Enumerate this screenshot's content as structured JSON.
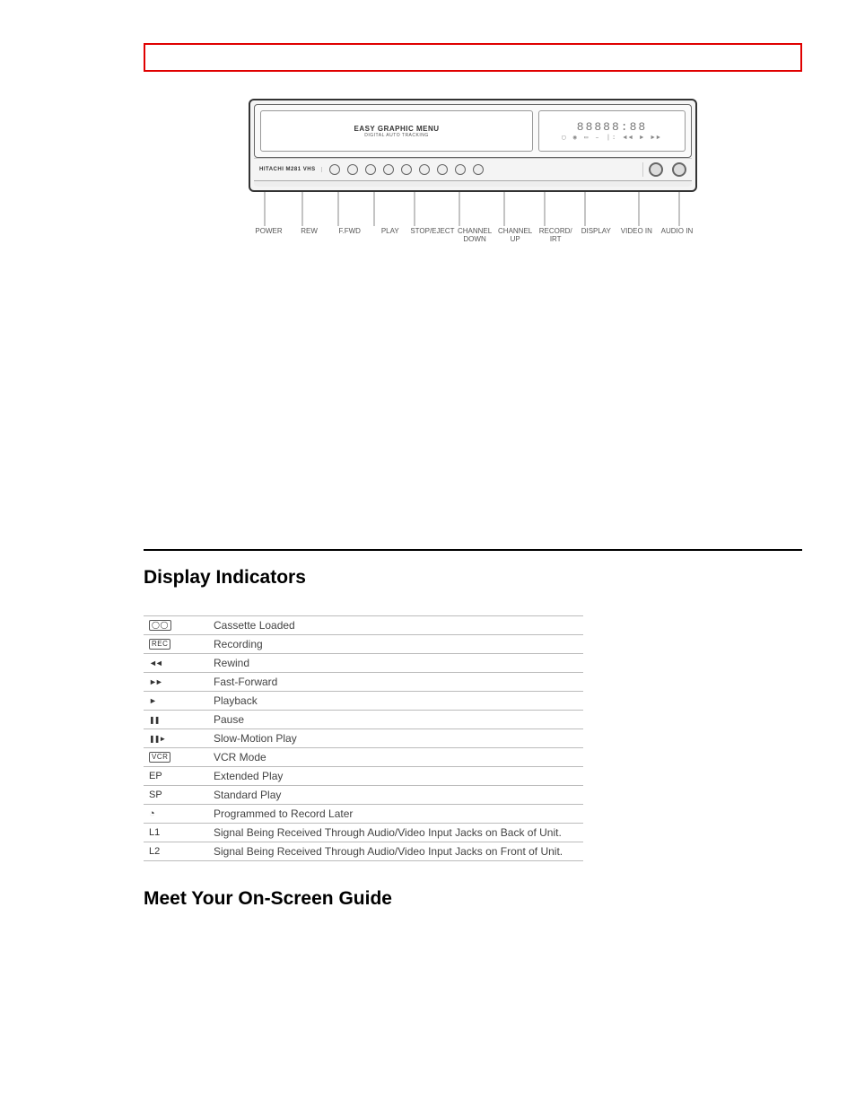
{
  "diagram": {
    "menu_title": "EASY GRAPHIC MENU",
    "menu_sub": "DIGITAL AUTO TRACKING",
    "clock_placeholder": "88888:88",
    "icon_row": "▢ ◉ ▭ – |: ◄◄ ► ►►",
    "brand": "HITACHI M281",
    "brand_extra": "VHS",
    "button_labels": [
      "POWER",
      "REW",
      "F.FWD",
      "PLAY",
      "STOP/EJECT",
      "CHANNEL DOWN",
      "CHANNEL UP",
      "RECORD/ IRT",
      "DISPLAY",
      "VIDEO IN",
      "AUDIO IN"
    ]
  },
  "sections": {
    "display_indicators": "Display Indicators",
    "onscreen_guide": "Meet Your On-Screen Guide"
  },
  "indicators": [
    {
      "symbol_type": "box",
      "symbol_text": "◯◯",
      "desc": "Cassette Loaded"
    },
    {
      "symbol_type": "box",
      "symbol_text": "REC",
      "desc": "Recording"
    },
    {
      "symbol_type": "glyph",
      "glyph_class": "tri-dbl-l",
      "desc": "Rewind"
    },
    {
      "symbol_type": "glyph",
      "glyph_class": "tri-dbl-r",
      "desc": "Fast-Forward"
    },
    {
      "symbol_type": "glyph",
      "glyph_class": "tri-r",
      "desc": "Playback"
    },
    {
      "symbol_type": "glyph",
      "glyph_class": "pause",
      "desc": "Pause"
    },
    {
      "symbol_type": "glyph",
      "glyph_class": "slow",
      "desc": "Slow-Motion Play"
    },
    {
      "symbol_type": "box",
      "symbol_text": "VCR",
      "desc": "VCR Mode"
    },
    {
      "symbol_type": "text",
      "symbol_text": "EP",
      "desc": "Extended Play"
    },
    {
      "symbol_type": "text",
      "symbol_text": "SP",
      "desc": "Standard Play"
    },
    {
      "symbol_type": "glyph",
      "glyph_class": "clockicon",
      "desc": "Programmed to Record Later"
    },
    {
      "symbol_type": "text",
      "symbol_text": "L1",
      "desc": "Signal Being Received Through Audio/Video Input Jacks on Back of Unit."
    },
    {
      "symbol_type": "text",
      "symbol_text": "L2",
      "desc": "Signal Being Received Through Audio/Video Input Jacks on Front of Unit."
    }
  ]
}
